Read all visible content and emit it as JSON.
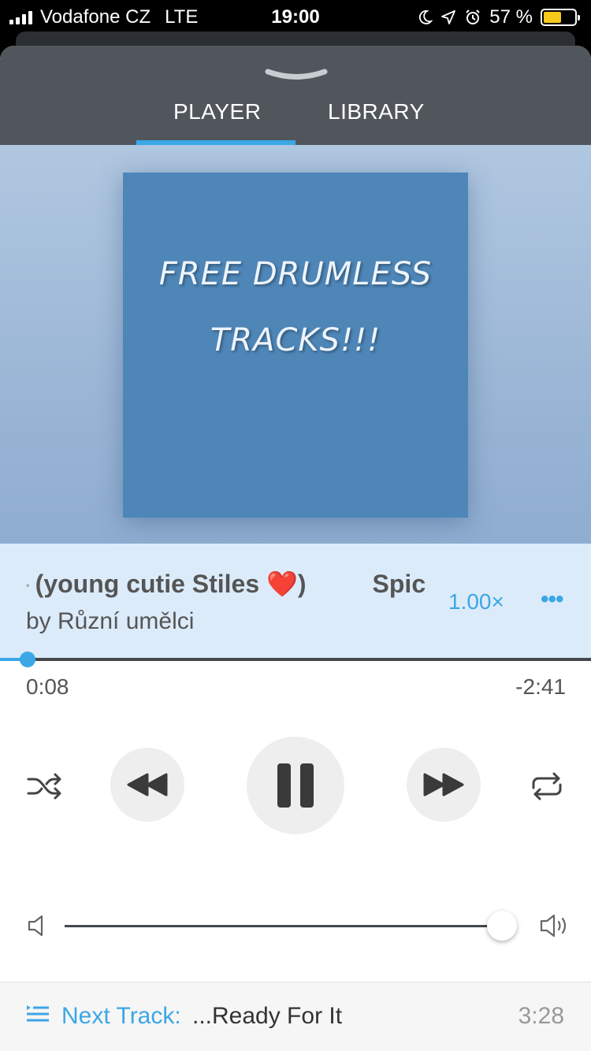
{
  "status_bar": {
    "carrier": "Vodafone CZ",
    "network": "LTE",
    "time": "19:00",
    "battery_percent": "57 %",
    "battery_level": 0.57,
    "battery_color": "#f7c91b"
  },
  "tabs": [
    {
      "label": "PLAYER",
      "active": true
    },
    {
      "label": "LIBRARY",
      "active": false
    }
  ],
  "artwork": {
    "line1": "FREE DRUMLESS",
    "line2": "TRACKS!!!",
    "background": "#4e86b8"
  },
  "track": {
    "title_fragment": "(young cutie Stiles ❤️)",
    "title_next_fragment": "Spic",
    "artist": "by Různí umělci",
    "speed": "1.00×",
    "more_label": "•••"
  },
  "progress": {
    "elapsed": "0:08",
    "remaining": "-2:41",
    "fraction": 0.047
  },
  "controls": {
    "shuffle_icon": "shuffle-icon",
    "rewind_icon": "rewind-icon",
    "pause_icon": "pause-icon",
    "forward_icon": "fast-forward-icon",
    "repeat_icon": "repeat-icon"
  },
  "volume": {
    "level": 0.97
  },
  "next_track": {
    "label": "Next Track:",
    "title": "...Ready For It",
    "duration": "3:28"
  },
  "colors": {
    "accent": "#3ba7e6",
    "header": "#50565c",
    "info_band": "#dcebfa"
  }
}
